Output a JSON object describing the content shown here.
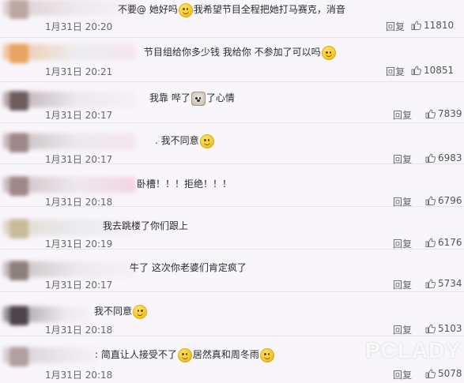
{
  "reply_label": "回复",
  "watermark": "PCLADY",
  "comments": [
    {
      "text_before": "不要@ 她好吗",
      "emoji1": "smile-emoji",
      "text_after": "我希望节目全程把她打马赛克，消音",
      "emoji2": "",
      "text_end": "",
      "time": "1月31日 20:20",
      "likes": "11810"
    },
    {
      "text_before": "节目组给你多少钱 我给你 不参加了可以吗",
      "emoji1": "angry-emoji",
      "text_after": "",
      "emoji2": "",
      "text_end": "",
      "time": "1月31日 20:21",
      "likes": "10851"
    },
    {
      "text_before": "我靠 哔了",
      "emoji1": "dog-emoji",
      "text_after": "了心情",
      "emoji2": "",
      "text_end": "",
      "time": "1月31日 20:17",
      "likes": "7839"
    },
    {
      "text_before": ". 我不同意",
      "emoji1": "smile-emoji",
      "text_after": "",
      "emoji2": "",
      "text_end": "",
      "time": "1月31日 20:17",
      "likes": "6983"
    },
    {
      "text_before": "卧槽！！！拒绝！！！",
      "emoji1": "",
      "text_after": "",
      "emoji2": "",
      "text_end": "",
      "time": "1月31日 20:18",
      "likes": "6796"
    },
    {
      "text_before": "我去跳楼了你们跟上",
      "emoji1": "",
      "text_after": "",
      "emoji2": "",
      "text_end": "",
      "time": "1月31日 20:19",
      "likes": "6176"
    },
    {
      "text_before": "牛了 这次你老婆们肯定疯了",
      "emoji1": "",
      "text_after": "",
      "emoji2": "",
      "text_end": "",
      "time": "1月31日 20:17",
      "likes": "5734"
    },
    {
      "text_before": "我不同意",
      "emoji1": "smile-emoji",
      "text_after": "",
      "emoji2": "",
      "text_end": "",
      "time": "1月31日 20:18",
      "likes": "5103"
    },
    {
      "text_before": ": 简直让人接受不了",
      "emoji1": "think-emoji",
      "text_after": "居然真和周冬雨",
      "emoji2": "think-emoji",
      "text_end": "",
      "time": "1月31日 20:18",
      "likes": "5078"
    }
  ]
}
